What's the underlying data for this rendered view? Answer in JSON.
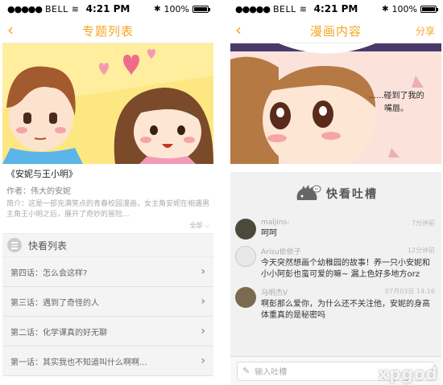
{
  "status_bar": {
    "carrier": "BELL",
    "time": "4:21 PM",
    "battery": "100%"
  },
  "left_screen": {
    "nav": {
      "back_icon": "chevron-left-icon",
      "title": "专题列表"
    },
    "book": {
      "title": "《安妮与王小明》",
      "author": "作者：伟大的安妮",
      "intro": "简介：这是一部充满笑点的青春校园漫画，女主角安妮在相遇男主角王小明之后，展开了奇妙的冒险...",
      "more": "全部 ⌵"
    },
    "section": {
      "icon": "list-icon",
      "label": "快看列表"
    },
    "chapters": [
      {
        "label": "第四话：怎么会这样?"
      },
      {
        "label": "第三话：遇到了奇怪的人"
      },
      {
        "label": "第二话：化学课真的好无聊"
      },
      {
        "label": "第一话：其实我也不知道叫什么啊啊..."
      }
    ]
  },
  "right_screen": {
    "nav": {
      "back_icon": "chevron-left-icon",
      "title": "漫画内容",
      "share": "分享"
    },
    "comic": {
      "speech": "......碰到了我的嘴唇。"
    },
    "brand": {
      "logo_icon": "hedgehog-chat-icon",
      "label": "快看吐槽"
    },
    "comments": [
      {
        "user": "maljins-",
        "time": "7分钟前",
        "text": "呵呵",
        "avatar_color": "#4a4a3a"
      },
      {
        "user": "Arisu依依子",
        "time": "12分钟前",
        "text": "今天突然想画个幼稚园的故事！养一只小安妮和小小阿彭也蛮可爱的嘛~ 漏上色好多地方orz",
        "avatar_color": "#e8e8e8"
      },
      {
        "user": "马明杰V",
        "time": "07月03日 14:16",
        "text": "啊彭那么爱你，为什么还不关注他，安妮的身高体重真的是秘密吗",
        "avatar_color": "#7a6a50"
      }
    ],
    "input": {
      "placeholder": "输入吐槽",
      "icon": "edit-icon"
    },
    "watermark": "xpgod"
  },
  "colors": {
    "accent": "#f5a623"
  }
}
